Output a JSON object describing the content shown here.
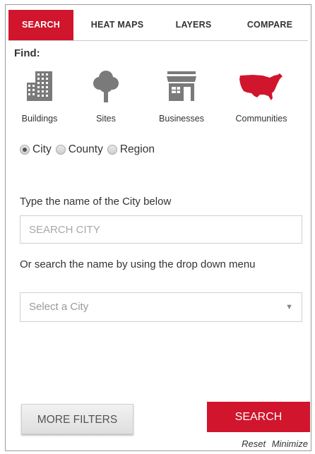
{
  "tabs": [
    {
      "label": "SEARCH",
      "active": true
    },
    {
      "label": "HEAT MAPS",
      "active": false
    },
    {
      "label": "LAYERS",
      "active": false
    },
    {
      "label": "COMPARE",
      "active": false
    }
  ],
  "find_label": "Find:",
  "categories": [
    {
      "label": "Buildings",
      "icon": "buildings-icon"
    },
    {
      "label": "Sites",
      "icon": "tree-icon"
    },
    {
      "label": "Businesses",
      "icon": "storefront-icon"
    },
    {
      "label": "Communities",
      "icon": "usa-map-icon"
    }
  ],
  "radios": [
    {
      "label": "City",
      "checked": true
    },
    {
      "label": "County",
      "checked": false
    },
    {
      "label": "Region",
      "checked": false
    }
  ],
  "search": {
    "prompt": "Type the name of the City below",
    "placeholder": "SEARCH CITY",
    "value": ""
  },
  "dropdown": {
    "prompt": "Or search the name by using the drop down menu",
    "selected": "Select a City"
  },
  "buttons": {
    "more_filters": "MORE FILTERS",
    "search": "SEARCH",
    "reset": "Reset",
    "minimize": "Minimize"
  },
  "colors": {
    "accent": "#d0152d",
    "icon_gray": "#7a7a7a"
  }
}
